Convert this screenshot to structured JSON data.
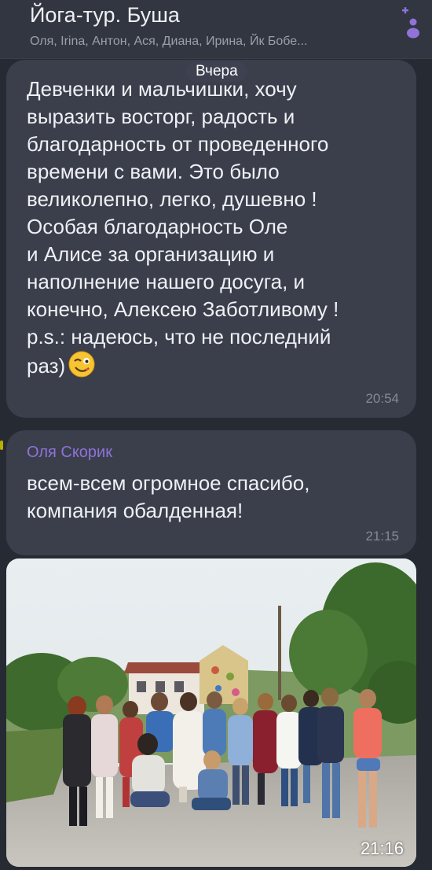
{
  "chat": {
    "title": "Йога-тур. Буша",
    "members": "Оля, Irina, Антон, Ася, Диана, Ирина, Йк Бобе..."
  },
  "icons": {
    "add_member": "add-member-icon",
    "emoji": "winking-face-emoji"
  },
  "colors": {
    "accent": "#8f73d8",
    "background": "#262a33",
    "bubble": "#3b3f4c"
  },
  "date_divider": "Вчера",
  "messages": [
    {
      "text": "Девченки и мальчишки, хочу\nвыразить восторг, радость и\nблагодарность от проведенного\nвремени с вами.  Это было\nвеликолепно, легко, душевно !\nОсобая благодарность Оле\nи Алисе за организацию и\nнаполнение нашего досуга, и\nконечно, Алексею Заботливому !\np.s.:  надеюсь, что не последний\nраз)",
      "time": "20:54"
    },
    {
      "sender": "Оля Скорик",
      "text": "всем-всем огромное спасибо,\nкомпания обалденная!",
      "time": "21:15"
    },
    {
      "type": "photo",
      "time": "21:16"
    }
  ]
}
